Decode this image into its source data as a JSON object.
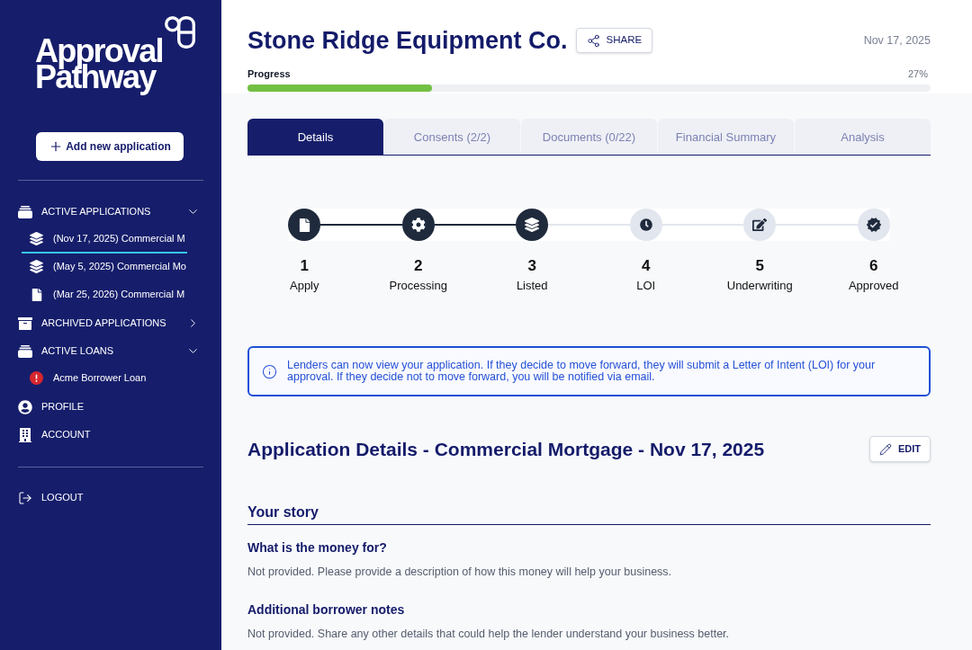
{
  "sidebar": {
    "logo_lines": [
      "Approval",
      "Pathway"
    ],
    "add_button": "Add new application",
    "nav": [
      {
        "label": "ACTIVE APPLICATIONS",
        "expanded": true,
        "children": [
          {
            "label": "(Nov 17, 2025) Commercial M",
            "selected": true
          },
          {
            "label": "(May 5, 2025) Commercial Mo",
            "selected": false
          },
          {
            "label": "(Mar 25, 2026) Commercial M",
            "selected": false
          }
        ]
      },
      {
        "label": "ARCHIVED APPLICATIONS",
        "expanded": false
      },
      {
        "label": "ACTIVE LOANS",
        "expanded": true,
        "children": [
          {
            "label": "Acme Borrower Loan",
            "selected": false,
            "alert": true
          }
        ]
      },
      {
        "label": "PROFILE"
      },
      {
        "label": "ACCOUNT"
      }
    ],
    "logout": "LOGOUT"
  },
  "header": {
    "title": "Stone Ridge Equipment Co.",
    "share_button": "SHARE",
    "date": "Nov 17, 2025"
  },
  "progress": {
    "label": "Progress",
    "value": "27%",
    "level": 0.27
  },
  "tabs": [
    {
      "label": "Details",
      "selected": true
    },
    {
      "label": "Consents (2/2)",
      "selected": false
    },
    {
      "label": "Documents (0/22)",
      "selected": false
    },
    {
      "label": "Financial Summary",
      "selected": false
    },
    {
      "label": "Analysis",
      "selected": false
    }
  ],
  "steps": [
    {
      "number": "1",
      "label": "Apply",
      "done": true
    },
    {
      "number": "2",
      "label": "Processing",
      "done": true
    },
    {
      "number": "3",
      "label": "Listed",
      "done": true
    },
    {
      "number": "4",
      "label": "LOI",
      "done": false
    },
    {
      "number": "5",
      "label": "Underwriting",
      "done": false
    },
    {
      "number": "6",
      "label": "Approved",
      "done": false
    }
  ],
  "notice": "Lenders can now view your application. If they decide to move forward, they will submit a Letter of Intent (LOI) for your approval. If they decide not to move forward, you will be notified via email.",
  "details": {
    "heading": "Application Details - Commercial Mortgage - Nov 17, 2025",
    "edit_button": "EDIT",
    "section_title": "Your story",
    "fields": [
      {
        "question": "What is the money for?",
        "answer": "Not provided. Please provide a description of how this money will help your business."
      },
      {
        "question": "Additional borrower notes",
        "answer": "Not provided. Share any other details that could help the lender understand your business better."
      }
    ]
  }
}
